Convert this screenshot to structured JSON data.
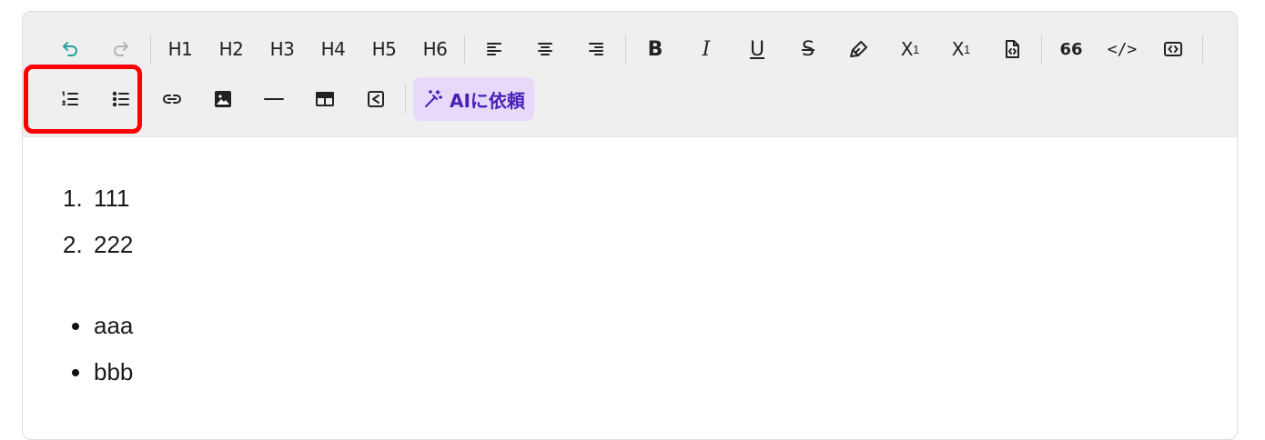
{
  "toolbar": {
    "row1": {
      "undo": "undo-icon",
      "redo": "redo-icon",
      "headings": [
        "H1",
        "H2",
        "H3",
        "H4",
        "H5",
        "H6"
      ],
      "align": [
        "align-left-icon",
        "align-center-icon",
        "align-right-icon"
      ],
      "bold": "B",
      "italic": "I",
      "underline": "U",
      "strike": "S",
      "highlight": "highlighter-icon",
      "subscript_base": "X",
      "subscript_mark": "1",
      "superscript_base": "X",
      "superscript_mark": "1",
      "code_file": "code-file-icon",
      "quote": "66",
      "code": "</>",
      "embed": "embed-code-icon"
    },
    "row2": {
      "ordered_list": "ordered-list-icon",
      "bullet_list": "bullet-list-icon",
      "link": "link-icon",
      "image": "image-icon",
      "horizontal_rule": "horizontal-rule-icon",
      "table": "table-icon",
      "share": "share-icon",
      "ai_button_label": "AIに依頼"
    }
  },
  "content": {
    "ordered_list": [
      {
        "marker": "1.",
        "text": "111"
      },
      {
        "marker": "2.",
        "text": "222"
      }
    ],
    "bullet_list": [
      {
        "text": "aaa"
      },
      {
        "text": "bbb"
      }
    ]
  },
  "colors": {
    "highlight_box": "#ff0000",
    "ai_button_bg": "#e6d9fa",
    "ai_button_fg": "#4a21b8",
    "undo_color": "#2a9d9d",
    "toolbar_bg": "#efefef"
  }
}
